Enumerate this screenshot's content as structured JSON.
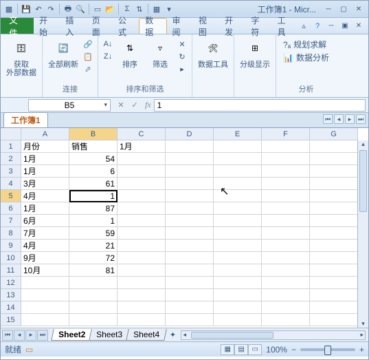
{
  "title": "工作簿1 - Micr...",
  "menu": {
    "file": "文件",
    "items": [
      "开始",
      "插入",
      "页面",
      "公式",
      "数据",
      "审阅",
      "视图",
      "开发",
      "字符",
      "工具"
    ],
    "active": 4
  },
  "ribbon": {
    "g1": {
      "btn": "获取\n外部数据",
      "label": "  "
    },
    "g2": {
      "btn": "全部刷新",
      "label": "连接"
    },
    "g3": {
      "sort": "排序",
      "label": "排序和筛选"
    },
    "g4": {
      "btn": "筛选"
    },
    "g5": {
      "btn": "数据工具"
    },
    "g6": {
      "btn": "分级显示"
    },
    "g7": {
      "a": "规划求解",
      "b": "数据分析",
      "label": "分析"
    }
  },
  "namebox": "B5",
  "formula": "1",
  "booktab": "工作簿1",
  "cols": [
    "A",
    "B",
    "C",
    "D",
    "E",
    "F",
    "G"
  ],
  "rows": [
    "1",
    "2",
    "3",
    "4",
    "5",
    "6",
    "7",
    "8",
    "9",
    "10",
    "11",
    "12",
    "13",
    "14",
    "15"
  ],
  "activeRow": 4,
  "activeCol": 1,
  "data": [
    [
      "月份",
      "销售",
      "1月",
      "",
      "",
      "",
      ""
    ],
    [
      "1月",
      "54",
      "",
      "",
      "",
      "",
      ""
    ],
    [
      "1月",
      "6",
      "",
      "",
      "",
      "",
      ""
    ],
    [
      "3月",
      "61",
      "",
      "",
      "",
      "",
      ""
    ],
    [
      "4月",
      "1",
      "",
      "",
      "",
      "",
      ""
    ],
    [
      "1月",
      "87",
      "",
      "",
      "",
      "",
      ""
    ],
    [
      "6月",
      "1",
      "",
      "",
      "",
      "",
      ""
    ],
    [
      "7月",
      "59",
      "",
      "",
      "",
      "",
      ""
    ],
    [
      "4月",
      "21",
      "",
      "",
      "",
      "",
      ""
    ],
    [
      "9月",
      "72",
      "",
      "",
      "",
      "",
      ""
    ],
    [
      "10月",
      "81",
      "",
      "",
      "",
      "",
      ""
    ],
    [
      "",
      "",
      "",
      "",
      "",
      "",
      ""
    ],
    [
      "",
      "",
      "",
      "",
      "",
      "",
      ""
    ],
    [
      "",
      "",
      "",
      "",
      "",
      "",
      ""
    ],
    [
      "",
      "",
      "",
      "",
      "",
      "",
      ""
    ]
  ],
  "sheets": [
    "Sheet2",
    "Sheet3",
    "Sheet4"
  ],
  "activeSheet": 0,
  "status": "就绪",
  "zoom": "100%"
}
